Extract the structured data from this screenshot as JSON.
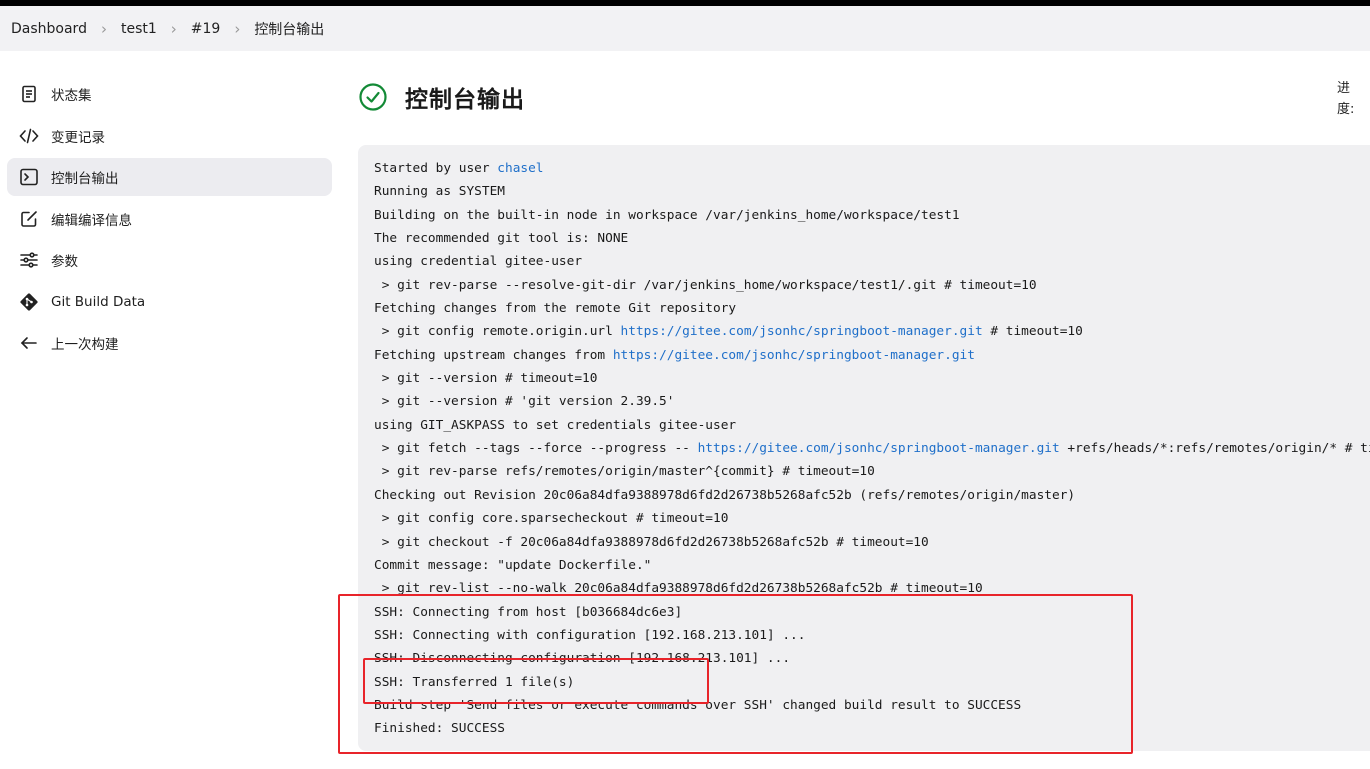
{
  "breadcrumb": [
    {
      "label": "Dashboard"
    },
    {
      "label": "test1"
    },
    {
      "label": "#19"
    },
    {
      "label": "控制台输出"
    }
  ],
  "sidebar": {
    "items": [
      {
        "label": "状态集",
        "icon": "document-icon"
      },
      {
        "label": "变更记录",
        "icon": "code-icon"
      },
      {
        "label": "控制台输出",
        "icon": "terminal-icon",
        "active": true
      },
      {
        "label": "编辑编译信息",
        "icon": "edit-icon"
      },
      {
        "label": "参数",
        "icon": "sliders-icon"
      },
      {
        "label": "Git Build Data",
        "icon": "git-icon"
      },
      {
        "label": "上一次构建",
        "icon": "arrow-left-icon"
      }
    ]
  },
  "main": {
    "title": "控制台输出",
    "status": "success",
    "progress_label": "进度:"
  },
  "console": {
    "lines": [
      [
        {
          "t": "Started by user "
        },
        {
          "t": "chasel",
          "link": true
        }
      ],
      [
        {
          "t": "Running as SYSTEM"
        }
      ],
      [
        {
          "t": "Building on the built-in node in workspace /var/jenkins_home/workspace/test1"
        }
      ],
      [
        {
          "t": "The recommended git tool is: NONE"
        }
      ],
      [
        {
          "t": "using credential gitee-user"
        }
      ],
      [
        {
          "t": " > git rev-parse --resolve-git-dir /var/jenkins_home/workspace/test1/.git # timeout=10"
        }
      ],
      [
        {
          "t": "Fetching changes from the remote Git repository"
        }
      ],
      [
        {
          "t": " > git config remote.origin.url "
        },
        {
          "t": "https://gitee.com/jsonhc/springboot-manager.git",
          "link": true
        },
        {
          "t": " # timeout=10"
        }
      ],
      [
        {
          "t": "Fetching upstream changes from "
        },
        {
          "t": "https://gitee.com/jsonhc/springboot-manager.git",
          "link": true
        }
      ],
      [
        {
          "t": " > git --version # timeout=10"
        }
      ],
      [
        {
          "t": " > git --version # 'git version 2.39.5'"
        }
      ],
      [
        {
          "t": "using GIT_ASKPASS to set credentials gitee-user"
        }
      ],
      [
        {
          "t": " > git fetch --tags --force --progress -- "
        },
        {
          "t": "https://gitee.com/jsonhc/springboot-manager.git",
          "link": true
        },
        {
          "t": " +refs/heads/*:refs/remotes/origin/* # ti"
        }
      ],
      [
        {
          "t": " > git rev-parse refs/remotes/origin/master^{commit} # timeout=10"
        }
      ],
      [
        {
          "t": "Checking out Revision 20c06a84dfa9388978d6fd2d26738b5268afc52b (refs/remotes/origin/master)"
        }
      ],
      [
        {
          "t": " > git config core.sparsecheckout # timeout=10"
        }
      ],
      [
        {
          "t": " > git checkout -f 20c06a84dfa9388978d6fd2d26738b5268afc52b # timeout=10"
        }
      ],
      [
        {
          "t": "Commit message: \"update Dockerfile.\""
        }
      ],
      [
        {
          "t": " > git rev-list --no-walk 20c06a84dfa9388978d6fd2d26738b5268afc52b # timeout=10"
        }
      ],
      [
        {
          "t": "SSH: Connecting from host [b036684dc6e3]"
        }
      ],
      [
        {
          "t": "SSH: Connecting with configuration [192.168.213.101] ..."
        }
      ],
      [
        {
          "t": "SSH: Disconnecting configuration [192.168.213.101] ..."
        }
      ],
      [
        {
          "t": "SSH: Transferred 1 file(s)"
        }
      ],
      [
        {
          "t": "Build step 'Send files or execute commands over SSH' changed build result to SUCCESS"
        }
      ],
      [
        {
          "t": "Finished: SUCCESS"
        }
      ]
    ]
  },
  "colors": {
    "link": "#1f6fc9",
    "success": "#138a36",
    "annotation": "#e8242a"
  }
}
